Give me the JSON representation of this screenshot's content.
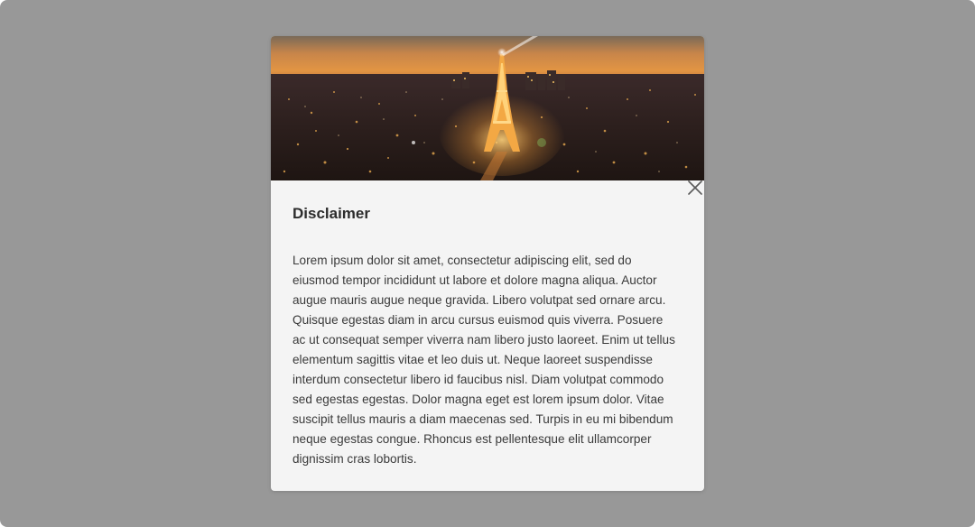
{
  "dialog": {
    "title": "Disclaimer",
    "body": "Lorem ipsum dolor sit amet, consectetur adipiscing elit, sed do eiusmod tempor incididunt ut labore et dolore magna aliqua. Auctor augue mauris augue neque gravida. Libero volutpat sed ornare arcu. Quisque egestas diam in arcu cursus euismod quis viverra. Posuere ac ut consequat semper viverra nam libero justo laoreet. Enim ut tellus elementum sagittis vitae et leo duis ut. Neque laoreet suspendisse interdum consectetur libero id faucibus nisl. Diam volutpat commodo sed egestas egestas. Dolor magna eget est lorem ipsum dolor. Vitae suscipit tellus mauris a diam maecenas sed. Turpis in eu mi bibendum neque egestas congue. Rhoncus est pellentesque elit ullamcorper dignissim cras lobortis.",
    "close_icon": "close-icon",
    "hero_image": "city-at-night-with-illuminated-tower"
  },
  "colors": {
    "overlay": "#989898",
    "dialog_background": "#f4f4f4",
    "title": "#2c2c2c",
    "body_text": "#3a3a3a",
    "close_icon": "#5a5a5a"
  }
}
